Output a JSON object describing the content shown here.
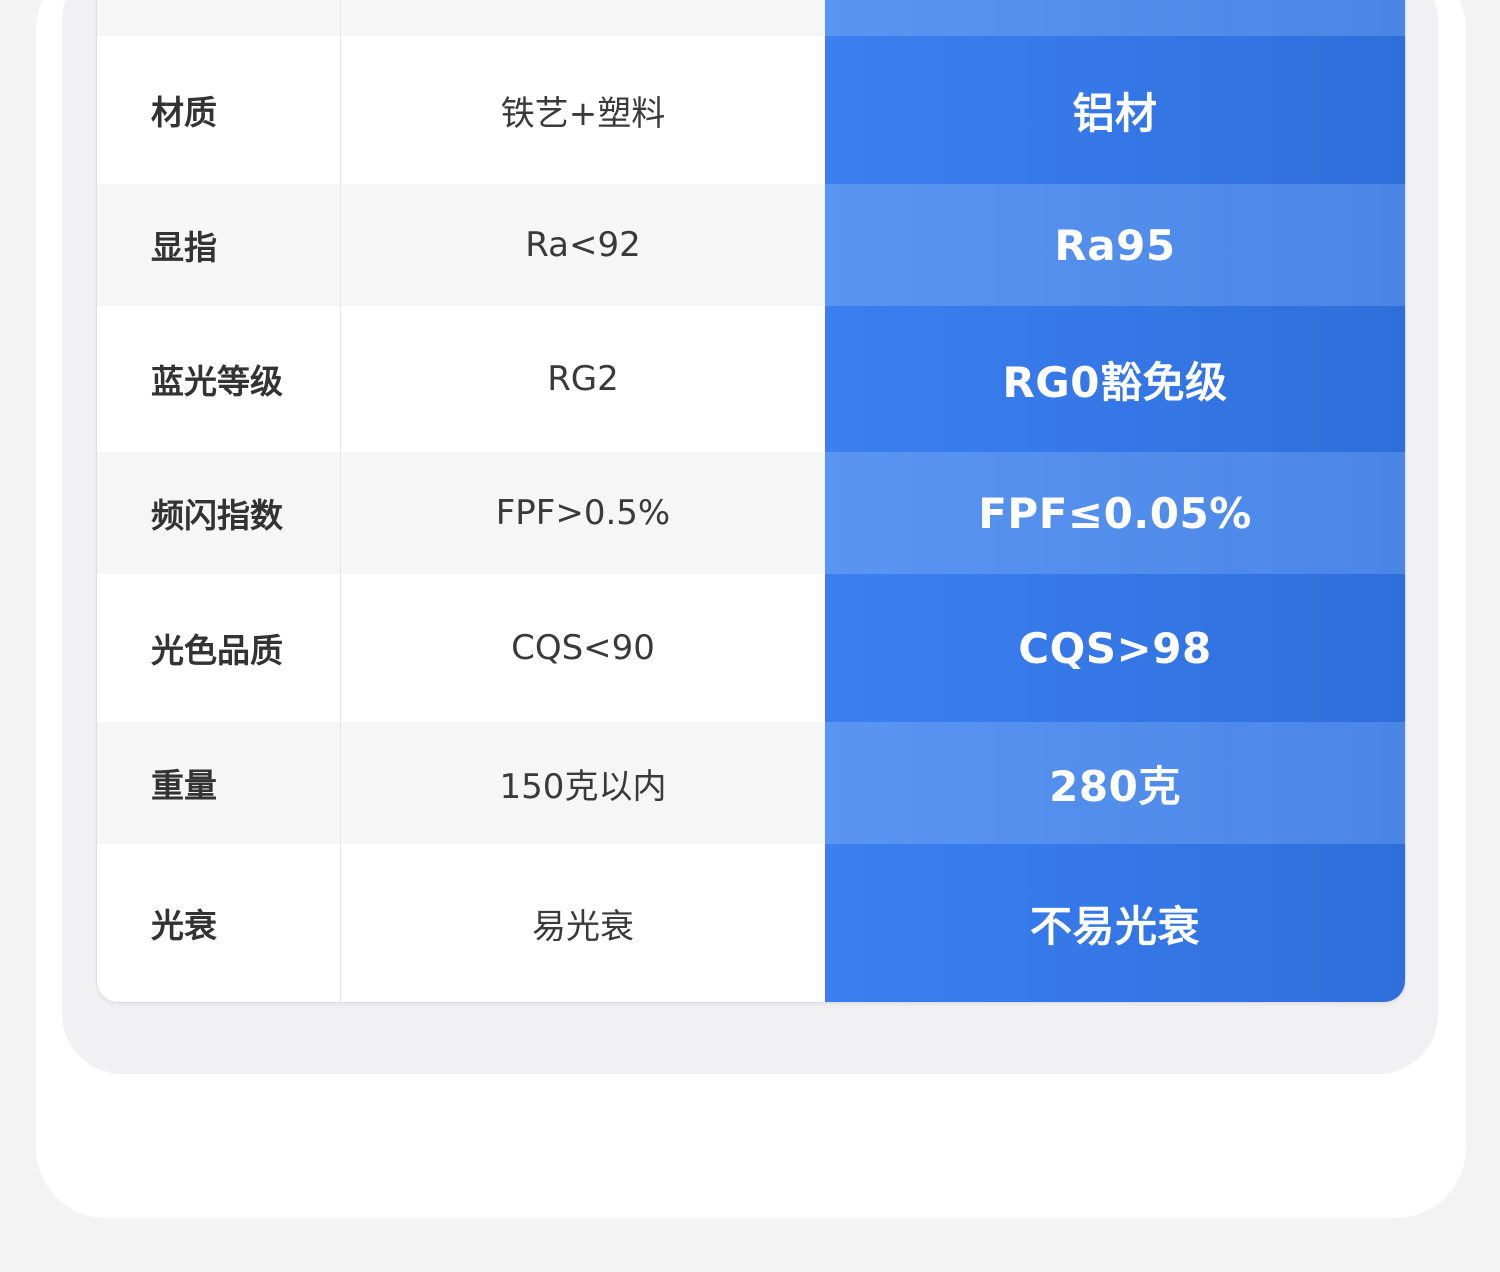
{
  "comparison": {
    "rows": [
      {
        "label": "",
        "other": "",
        "ours": ""
      },
      {
        "label": "材质",
        "other": "铁艺+塑料",
        "ours": "铝材"
      },
      {
        "label": "显指",
        "other": "Ra<92",
        "ours": "Ra95"
      },
      {
        "label": "蓝光等级",
        "other": "RG2",
        "ours": "RG0豁免级"
      },
      {
        "label": "频闪指数",
        "other": "FPF>0.5%",
        "ours": "FPF≤0.05%"
      },
      {
        "label": "光色品质",
        "other": "CQS<90",
        "ours": "CQS>98"
      },
      {
        "label": "重量",
        "other": "150克以内",
        "ours": "280克"
      },
      {
        "label": "光衰",
        "other": "易光衰",
        "ours": "不易光衰"
      }
    ]
  },
  "colors": {
    "accent_blue": "#3b7ff0",
    "accent_blue_light": "#5a95f2",
    "label_text": "#333333"
  }
}
